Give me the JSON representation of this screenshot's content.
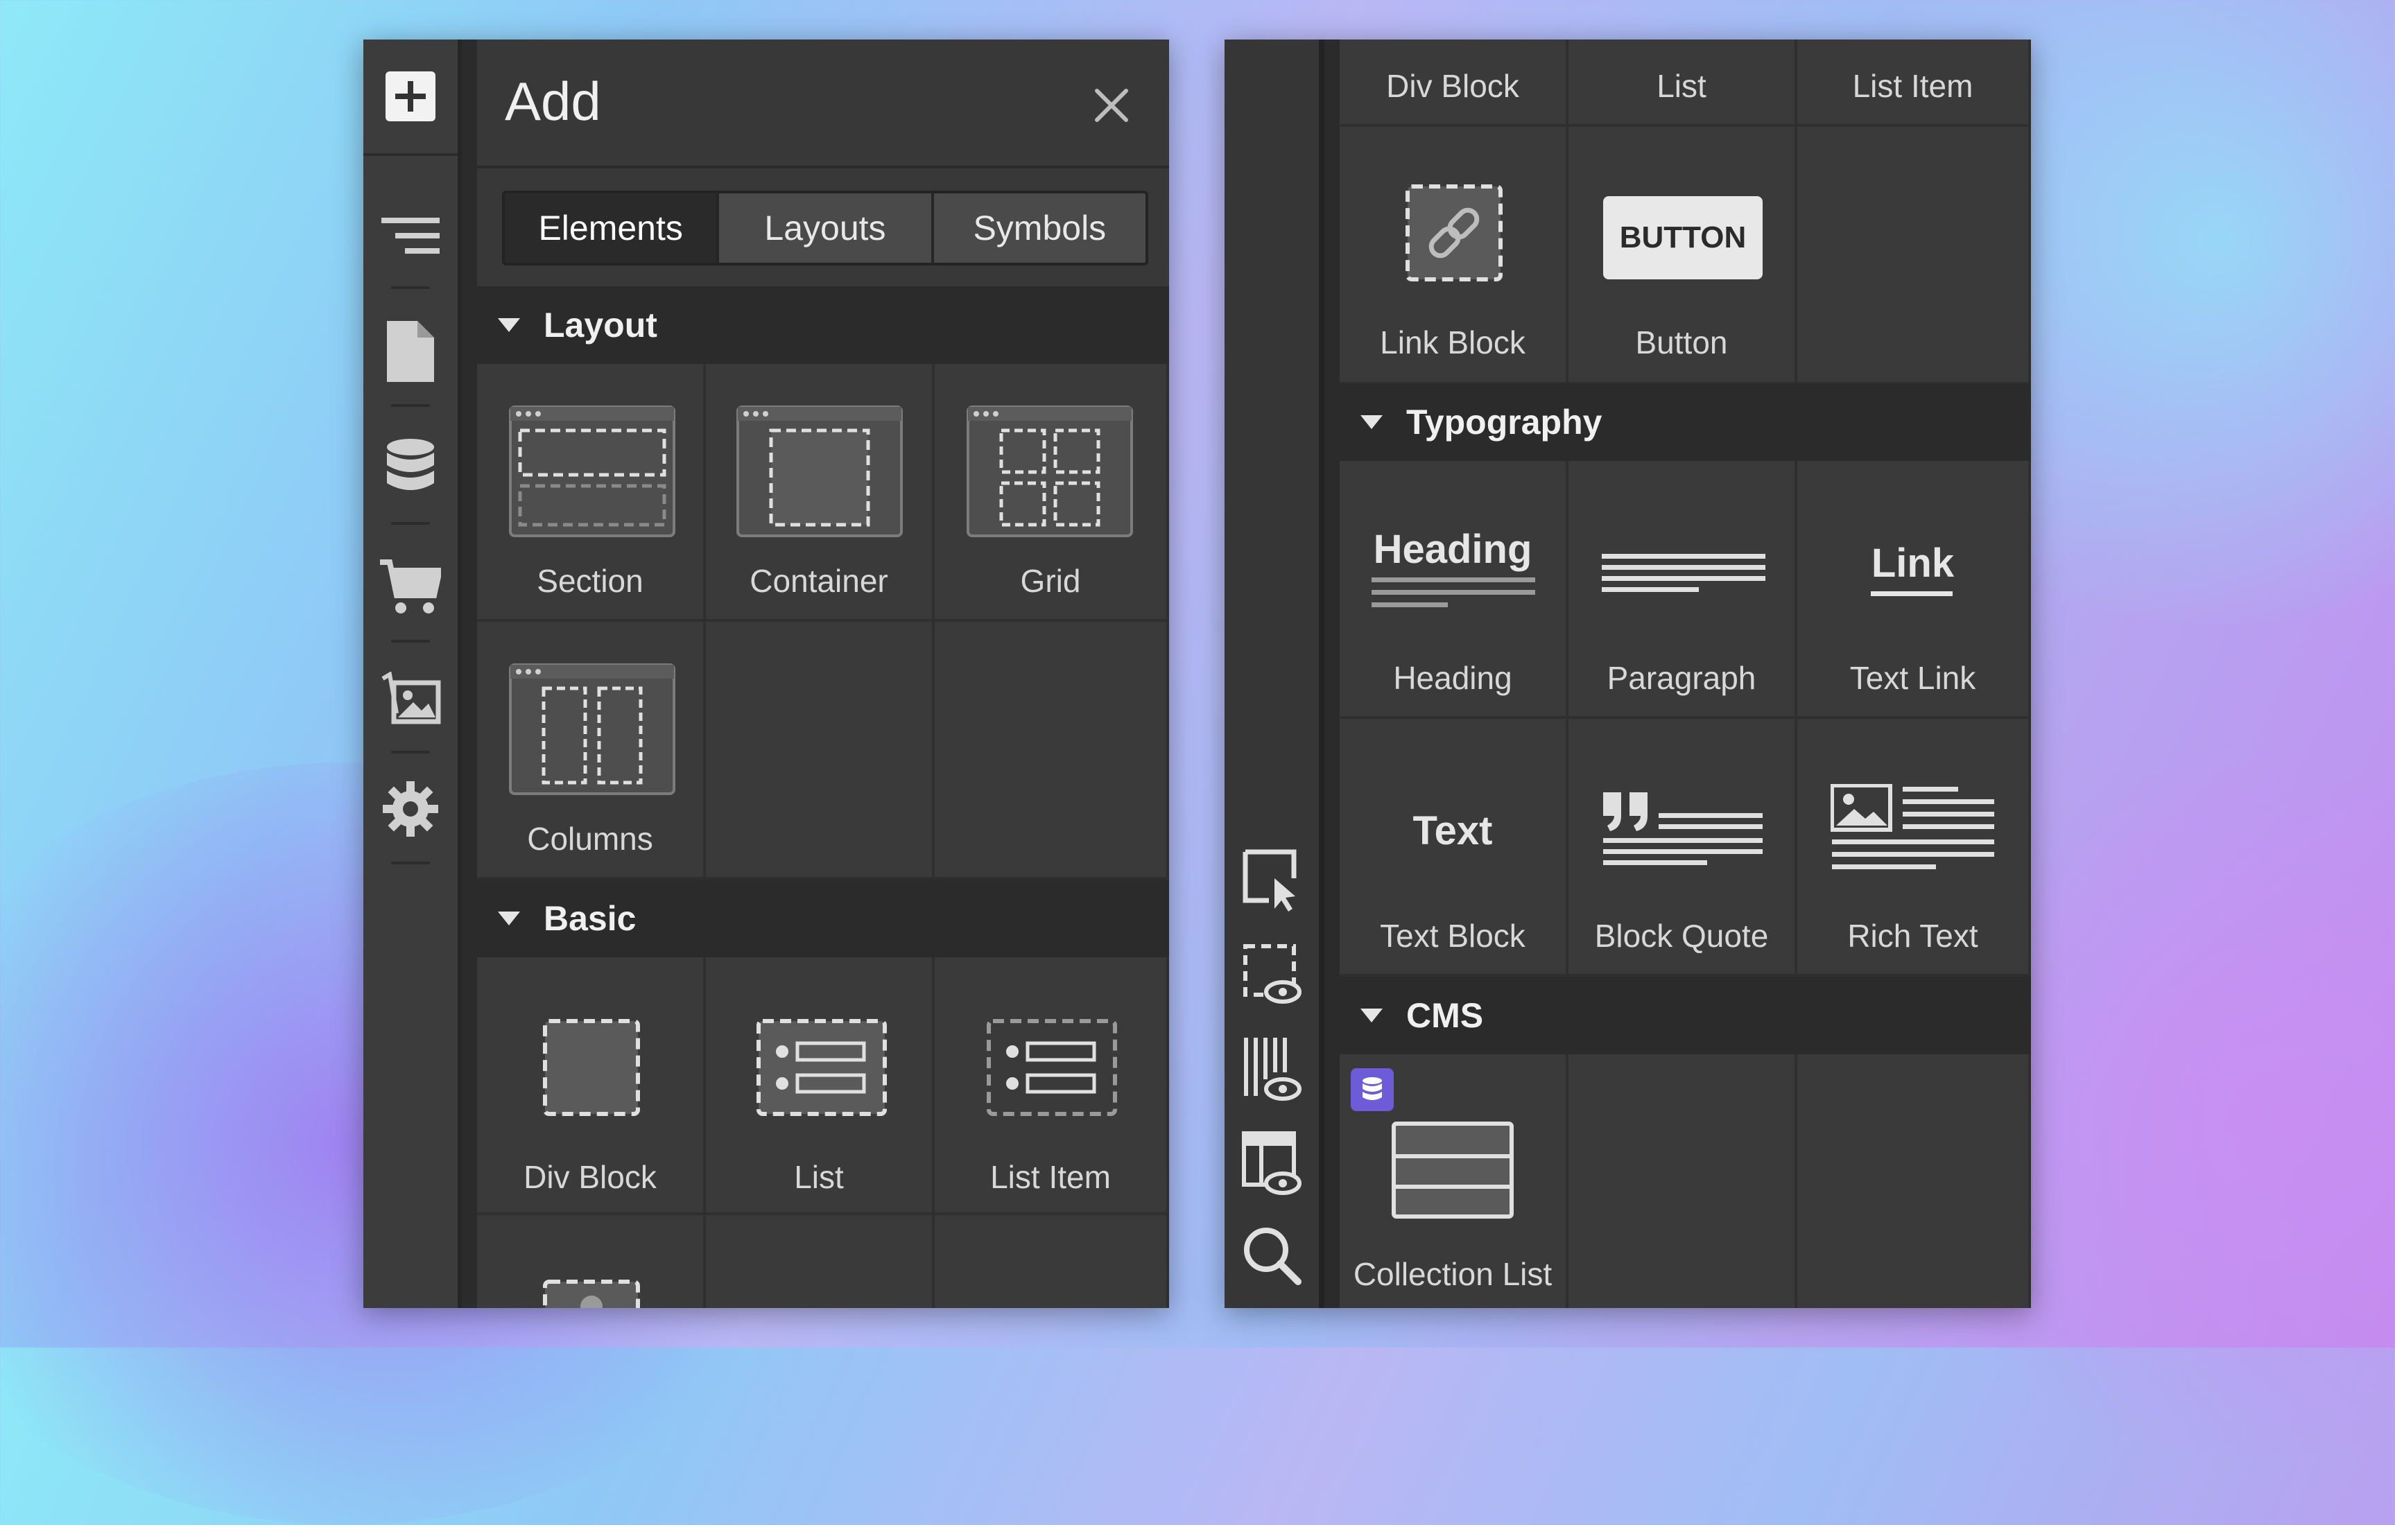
{
  "add_panel": {
    "title": "Add",
    "tabs": [
      "Elements",
      "Layouts",
      "Symbols"
    ],
    "sections": {
      "layout": {
        "label": "Layout",
        "items": [
          "Section",
          "Container",
          "Grid",
          "Columns"
        ]
      },
      "basic": {
        "label": "Basic",
        "items": [
          "Div Block",
          "List",
          "List Item"
        ]
      }
    }
  },
  "right_panel": {
    "top_labels": [
      "Div Block",
      "List",
      "List Item"
    ],
    "basic_items": [
      "Link Block",
      "Button"
    ],
    "button_icon_text": "BUTTON",
    "typography": {
      "label": "Typography",
      "items": [
        "Heading",
        "Paragraph",
        "Text Link",
        "Text Block",
        "Block Quote",
        "Rich Text"
      ],
      "icon_texts": {
        "heading": "Heading",
        "link": "Link",
        "text": "Text"
      }
    },
    "cms": {
      "label": "CMS",
      "items": [
        "Collection List"
      ]
    }
  },
  "rail_icons": [
    "add-icon",
    "navigator-icon",
    "pages-icon",
    "cms-database-icon",
    "ecommerce-cart-icon",
    "assets-icon",
    "settings-gear-icon"
  ],
  "tool_icons": [
    "select-element-icon",
    "preview-icon",
    "x-ray-icon",
    "template-preview-icon",
    "search-icon"
  ],
  "colors": {
    "accent_cms_badge": "#6e5bd8",
    "panel_bg": "#383838",
    "header_bg": "#2b2b2b"
  }
}
